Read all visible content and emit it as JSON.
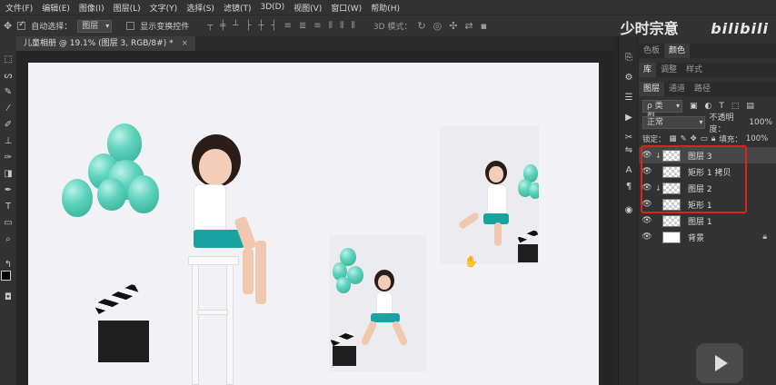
{
  "menu": [
    "文件(F)",
    "编辑(E)",
    "图像(I)",
    "图层(L)",
    "文字(Y)",
    "选择(S)",
    "滤镜(T)",
    "3D(D)",
    "视图(V)",
    "窗口(W)",
    "帮助(H)"
  ],
  "options": {
    "auto_select_label": "自动选择：",
    "auto_select_value": "图层",
    "transform_label": "显示变换控件",
    "mode3d_label": "3D 模式："
  },
  "watermark": {
    "author": "少时宗意",
    "site": "bilibili"
  },
  "document": {
    "tab_title": "儿童相册 @ 19.1% (图层 3, RGB/8#) *",
    "close": "×"
  },
  "panels": {
    "top_tabs": [
      "色板",
      "颜色"
    ],
    "mid_tabs": [
      "库",
      "调整",
      "样式"
    ],
    "layer_tabs": [
      "图层",
      "通道",
      "路径"
    ],
    "filter_label": "ρ 类型",
    "blend_mode": "正常",
    "opacity_label": "不透明度：",
    "opacity_value": "100%",
    "lock_label": "锁定：",
    "fill_label": "填充：",
    "fill_value": "100%"
  },
  "layers": [
    {
      "name": "图层 3",
      "clipped": true,
      "selected": true,
      "thumb": "checker"
    },
    {
      "name": "矩形 1 拷贝",
      "clipped": false,
      "selected": false,
      "thumb": "checker"
    },
    {
      "name": "图层 2",
      "clipped": true,
      "selected": false,
      "thumb": "checker"
    },
    {
      "name": "矩形 1",
      "clipped": false,
      "selected": false,
      "thumb": "checker"
    },
    {
      "name": "图层 1",
      "clipped": false,
      "selected": false,
      "thumb": "checker"
    },
    {
      "name": "背景",
      "clipped": false,
      "selected": false,
      "thumb": "white",
      "locked": true
    }
  ],
  "colors": {
    "highlight": "#e12020",
    "balloon": "#5ed3bd",
    "shorts": "#19a3a0"
  }
}
